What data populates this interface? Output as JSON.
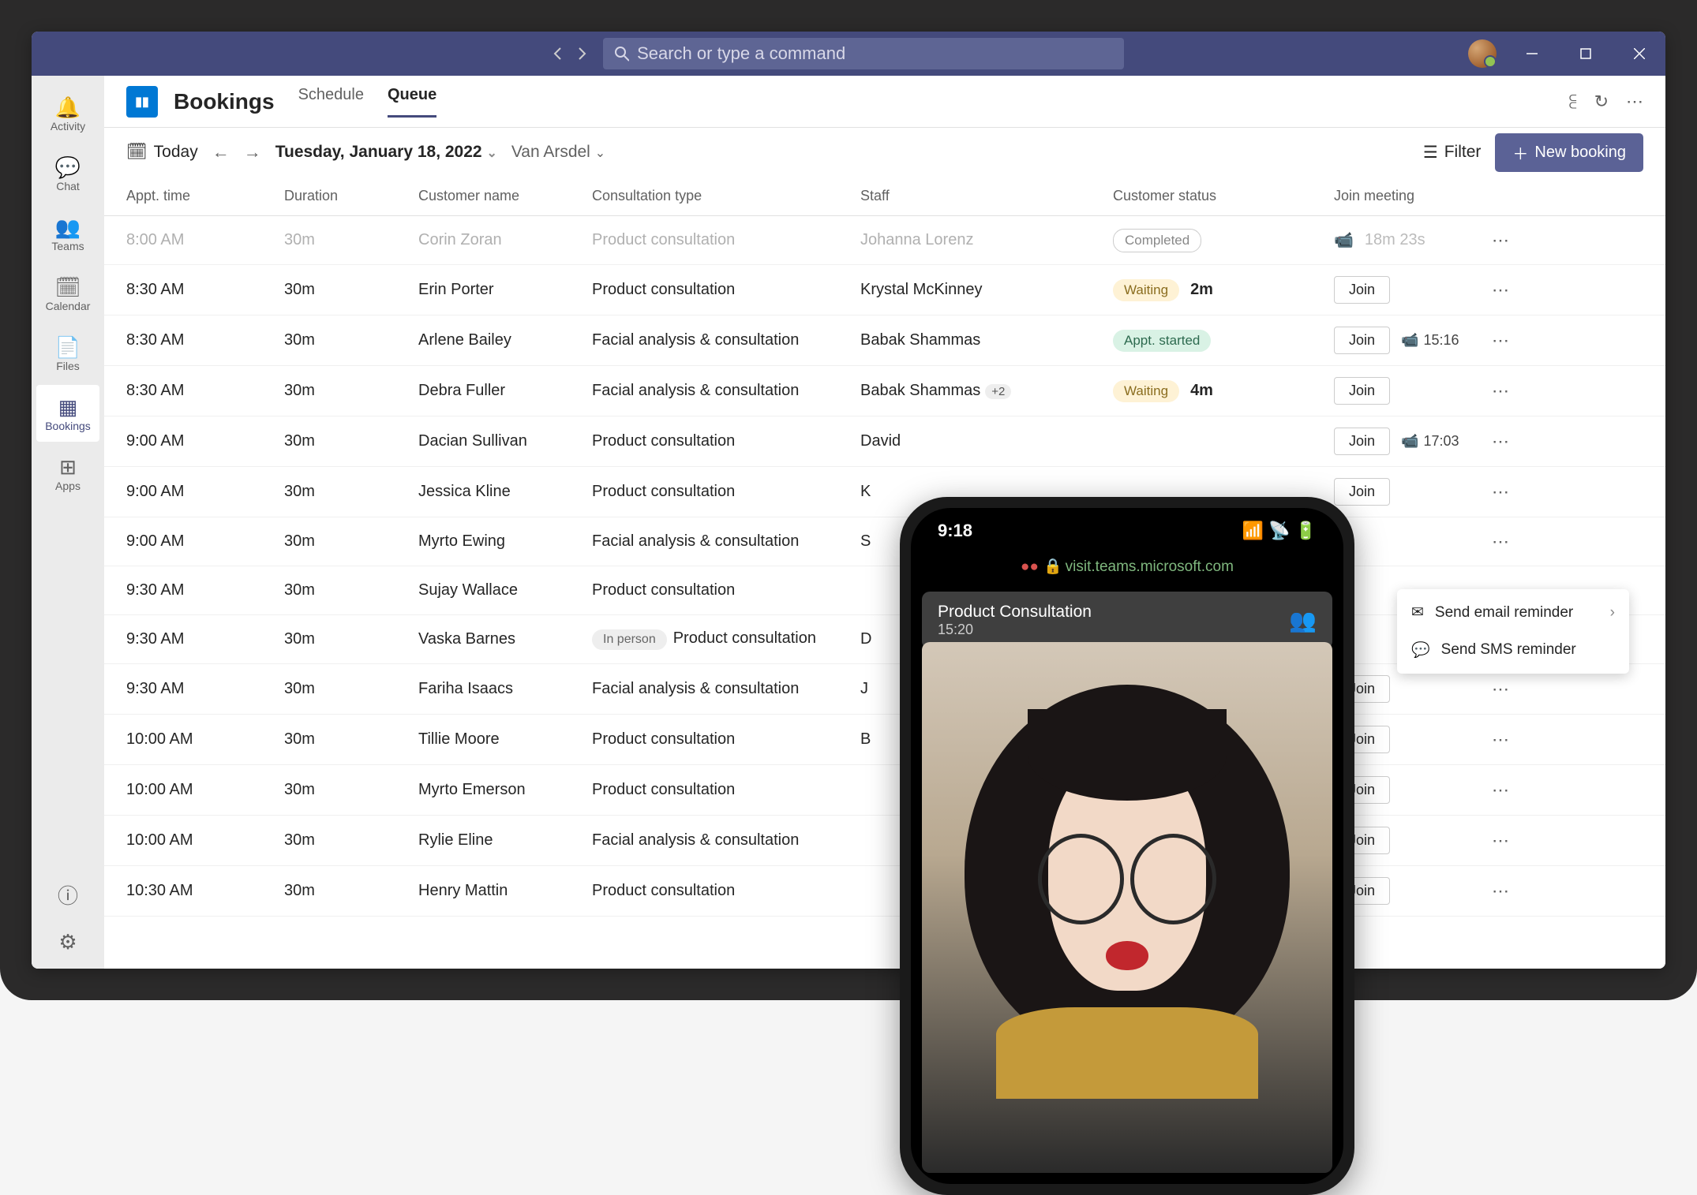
{
  "titlebar": {
    "search_placeholder": "Search or type a command"
  },
  "rail": {
    "items": [
      {
        "label": "Activity"
      },
      {
        "label": "Chat"
      },
      {
        "label": "Teams"
      },
      {
        "label": "Calendar"
      },
      {
        "label": "Files"
      },
      {
        "label": "Bookings"
      },
      {
        "label": "Apps"
      }
    ]
  },
  "page": {
    "title": "Bookings",
    "tabs": [
      "Schedule",
      "Queue"
    ],
    "active_tab": "Queue"
  },
  "toolbar": {
    "today": "Today",
    "date": "Tuesday, January 18, 2022",
    "org": "Van Arsdel",
    "filter": "Filter",
    "new_booking": "New booking"
  },
  "table": {
    "columns": [
      "Appt. time",
      "Duration",
      "Customer name",
      "Consultation type",
      "Staff",
      "Customer status",
      "Join meeting"
    ],
    "rows": [
      {
        "time": "8:00 AM",
        "duration": "30m",
        "customer": "Corin Zoran",
        "type": "Product consultation",
        "staff": "Johanna Lorenz",
        "status_kind": "completed",
        "status": "Completed",
        "join_kind": "elapsed",
        "join_text": "18m 23s",
        "faded": true
      },
      {
        "time": "8:30 AM",
        "duration": "30m",
        "customer": "Erin Porter",
        "type": "Product consultation",
        "staff": "Krystal McKinney",
        "status_kind": "waiting",
        "status": "Waiting",
        "status_extra": "2m",
        "join_kind": "join"
      },
      {
        "time": "8:30 AM",
        "duration": "30m",
        "customer": "Arlene Bailey",
        "type": "Facial analysis & consultation",
        "staff": "Babak Shammas",
        "status_kind": "started",
        "status": "Appt. started",
        "join_kind": "join_time",
        "join_time": "15:16"
      },
      {
        "time": "8:30 AM",
        "duration": "30m",
        "customer": "Debra Fuller",
        "type": "Facial analysis & consultation",
        "staff": "Babak Shammas",
        "staff_extra": "+2",
        "status_kind": "waiting",
        "status": "Waiting",
        "status_extra": "4m",
        "join_kind": "join"
      },
      {
        "time": "9:00 AM",
        "duration": "30m",
        "customer": "Dacian Sullivan",
        "type": "Product consultation",
        "staff": "David",
        "join_kind": "join_time",
        "join_time": "17:03"
      },
      {
        "time": "9:00 AM",
        "duration": "30m",
        "customer": "Jessica Kline",
        "type": "Product consultation",
        "staff": "K",
        "join_kind": "join"
      },
      {
        "time": "9:00 AM",
        "duration": "30m",
        "customer": "Myrto Ewing",
        "type": "Facial analysis & consultation",
        "staff": "S",
        "join_kind": "none"
      },
      {
        "time": "9:30 AM",
        "duration": "30m",
        "customer": "Sujay Wallace",
        "type": "Product consultation",
        "staff": "",
        "join_kind": "none"
      },
      {
        "time": "9:30 AM",
        "duration": "30m",
        "customer": "Vaska Barnes",
        "type": "Product consultation",
        "type_prefix": "In person",
        "staff": "D",
        "join_kind": "dash"
      },
      {
        "time": "9:30 AM",
        "duration": "30m",
        "customer": "Fariha Isaacs",
        "type": "Facial analysis & consultation",
        "staff": "J",
        "join_kind": "join"
      },
      {
        "time": "10:00 AM",
        "duration": "30m",
        "customer": "Tillie Moore",
        "type": "Product consultation",
        "staff": "B",
        "join_kind": "join"
      },
      {
        "time": "10:00 AM",
        "duration": "30m",
        "customer": "Myrto Emerson",
        "type": "Product consultation",
        "staff": "",
        "join_kind": "join"
      },
      {
        "time": "10:00 AM",
        "duration": "30m",
        "customer": "Rylie Eline",
        "type": "Facial analysis & consultation",
        "staff": "",
        "join_kind": "join"
      },
      {
        "time": "10:30 AM",
        "duration": "30m",
        "customer": "Henry Mattin",
        "type": "Product consultation",
        "staff": "",
        "join_kind": "join"
      }
    ],
    "join_label": "Join"
  },
  "context_menu": {
    "items": [
      {
        "label": "Send email reminder",
        "has_sub": true
      },
      {
        "label": "Send SMS reminder",
        "has_sub": false
      }
    ]
  },
  "phone": {
    "clock": "9:18",
    "url": "visit.teams.microsoft.com",
    "meeting_title": "Product Consultation",
    "meeting_time": "15:20"
  }
}
